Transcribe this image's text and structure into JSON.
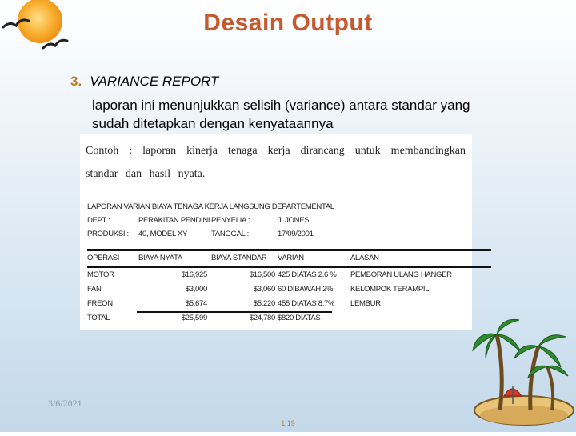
{
  "title": "Desain Output",
  "heading": {
    "number": "3.",
    "text": "VARIANCE REPORT"
  },
  "paragraph": "laporan ini menunjukkan selisih (variance) antara standar yang sudah ditetapkan dengan kenyataannya",
  "example": {
    "text": "Contoh : laporan kinerja tenaga kerja dirancang untuk membandingkan standar dan hasil nyata.",
    "report": {
      "title": "LAPORAN VARIAN BIAYA TENAGA KERJA LANGSUNG DEPARTEMENTAL",
      "dept_label": "DEPT :",
      "dept_value": "PERAKITAN PENDINI",
      "supervisor_label": "PENYELIA :",
      "supervisor_value": "J. JONES",
      "product_label": "PRODUKSI :",
      "product_value": "40, MODEL XY",
      "date_label": "TANGGAL :",
      "date_value": "17/09/2001",
      "columns": [
        "OPERASI",
        "BIAYA NYATA",
        "BIAYA STANDAR",
        "VARIAN",
        "ALASAN"
      ],
      "rows": [
        [
          "MOTOR",
          "$16,925",
          "$16,500",
          "425 DIATAS 2.6 %",
          "PEMBORAN ULANG HANGER"
        ],
        [
          "FAN",
          "$3,000",
          "$3,060",
          "60 DIBAWAH 2%",
          "KELOMPOK TERAMPIL"
        ],
        [
          "FREON",
          "$5,674",
          "$5,220",
          "455 DIATAS 8.7%",
          "LEMBUR"
        ]
      ],
      "total": [
        "TOTAL",
        "$25,599",
        "$24,780",
        "$820 DIATAS",
        ""
      ]
    }
  },
  "footer": {
    "date": "3/6/2021",
    "page": "1.19"
  },
  "colors": {
    "title": "#c65a2e",
    "accent": "#c07a1c",
    "sun": "#f59a1b"
  },
  "icons": [
    "sun-seagulls-icon",
    "palm-island-icon"
  ]
}
